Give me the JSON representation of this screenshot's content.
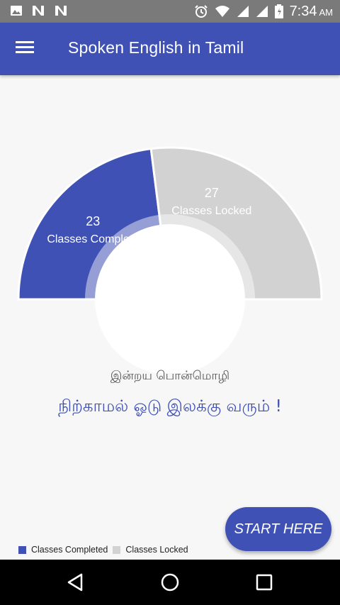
{
  "status_bar": {
    "time": "7:34",
    "ampm": "AM",
    "icons": [
      "image-icon",
      "n-icon",
      "n-icon",
      "alarm-icon",
      "wifi-icon",
      "signal-icon",
      "signal-icon",
      "battery-icon"
    ]
  },
  "app_bar": {
    "title": "Spoken English in Tamil",
    "menu_icon": "menu-icon"
  },
  "chart_data": {
    "type": "pie",
    "style": "half-donut",
    "slices": [
      {
        "label": "Classes Completed",
        "value": 23,
        "color": "#3f51b5"
      },
      {
        "label": "Classes Locked",
        "value": 27,
        "color": "#d2d2d2"
      }
    ],
    "slice_text": [
      {
        "value": "23",
        "label": "Classes Complete"
      },
      {
        "value": "27",
        "label": "Classes Locked"
      }
    ],
    "legend": {
      "position": "bottom-left",
      "items": [
        "Classes Completed",
        "Classes Locked"
      ]
    }
  },
  "quote": {
    "title": "இன்றய பொன்மொழி",
    "text": "நிற்காமல் ஓடு இலக்கு வரும் !"
  },
  "start_button": {
    "label": "START HERE"
  },
  "colors": {
    "primary": "#3f51b5",
    "locked": "#d2d2d2",
    "status_bar": "#7a7a7a"
  },
  "nav_bar": {
    "icons": [
      "back-icon",
      "home-icon",
      "recents-icon"
    ]
  }
}
